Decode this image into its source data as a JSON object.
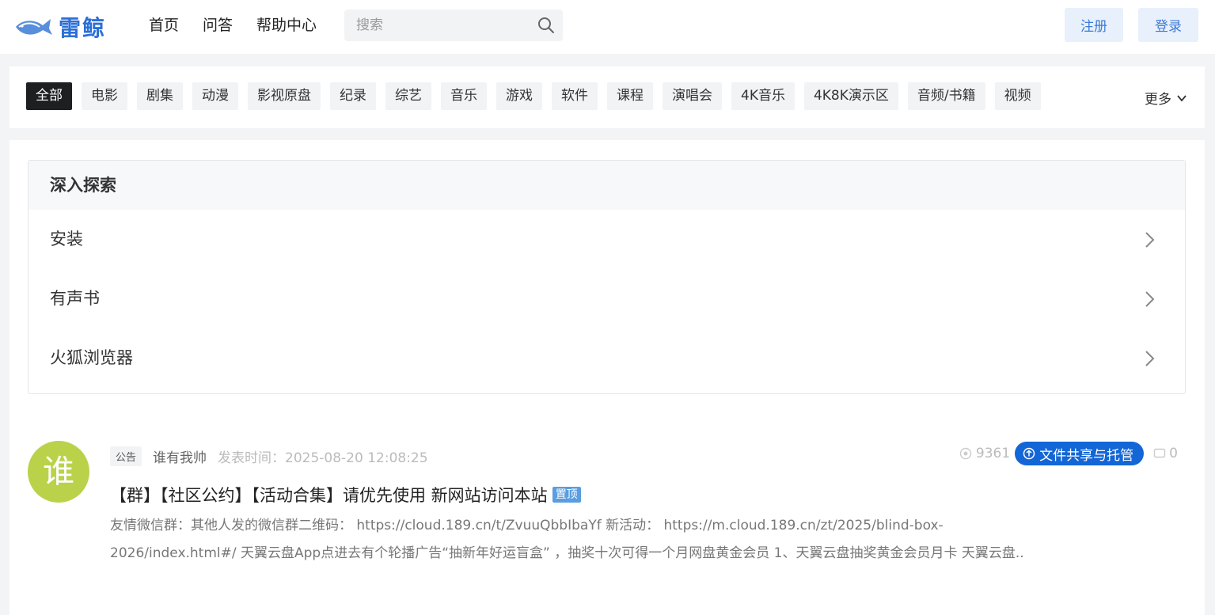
{
  "header": {
    "logo_text": "雷鲸",
    "nav": [
      "首页",
      "问答",
      "帮助中心"
    ],
    "search_placeholder": "搜索",
    "register_label": "注册",
    "login_label": "登录"
  },
  "categories": {
    "items": [
      "全部",
      "电影",
      "剧集",
      "动漫",
      "影视原盘",
      "纪录",
      "综艺",
      "音乐",
      "游戏",
      "软件",
      "课程",
      "演唱会",
      "4K音乐",
      "4K8K演示区",
      "音频/书籍",
      "视频"
    ],
    "active": "全部",
    "more_label": "更多"
  },
  "explore": {
    "title": "深入探索",
    "items": [
      "安装",
      "有声书",
      "火狐浏览器"
    ]
  },
  "post": {
    "avatar_char": "谁",
    "avatar_color": "#b9d24a",
    "tag": "公告",
    "author": "谁有我帅",
    "time": "发表时间：2025-08-20 12:08:25",
    "views": "9361",
    "category_badge": "文件共享与托管",
    "comments": "0",
    "title": "【群】【社区公约】【活动合集】请优先使用 新网站访问本站",
    "pin_label": "置顶",
    "excerpt": "友情微信群：其他人发的微信群二维码： https://cloud.189.cn/t/ZvuuQbbIbaYf 新活动： https://m.cloud.189.cn/zt/2025/blind-box-2026/index.html#/ 天翼云盘App点进去有个轮播广告“抽新年好运盲盒” ，抽奖十次可得一个月网盘黄金会员 1、天翼云盘抽奖黄金会员月卡 天翼云盘.."
  }
}
